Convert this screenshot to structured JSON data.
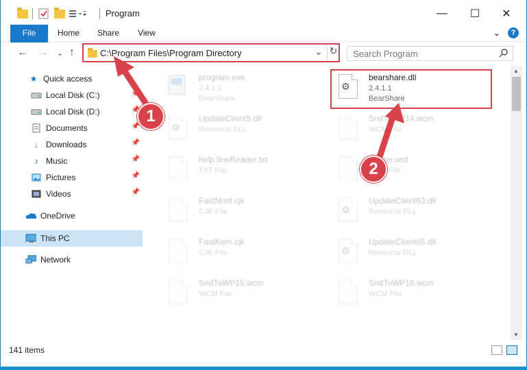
{
  "window": {
    "title": "Program",
    "minimize": "—",
    "maximize": "☐",
    "close": "✕"
  },
  "ribbon": {
    "tabs": [
      "File",
      "Home",
      "Share",
      "View"
    ],
    "expand": "⌄",
    "help": "?"
  },
  "nav": {
    "back": "←",
    "forward": "→",
    "recent": "⌄",
    "up": "↑"
  },
  "address": {
    "path": "C:\\Program Files\\Program Directory",
    "dropdown": "⌄",
    "refresh": "↻"
  },
  "search": {
    "placeholder": "Search Program",
    "icon": "⌕"
  },
  "sidebar": {
    "items": [
      {
        "label": "Quick access",
        "icon": "star-icon",
        "pinned": false
      },
      {
        "label": "Local Disk (C:)",
        "icon": "drive-icon",
        "pinned": true
      },
      {
        "label": "Local Disk (D:)",
        "icon": "drive-icon",
        "pinned": true
      },
      {
        "label": "Documents",
        "icon": "documents-icon",
        "pinned": true
      },
      {
        "label": "Downloads",
        "icon": "downloads-icon",
        "pinned": true
      },
      {
        "label": "Music",
        "icon": "music-icon",
        "pinned": true
      },
      {
        "label": "Pictures",
        "icon": "pictures-icon",
        "pinned": true
      },
      {
        "label": "Videos",
        "icon": "videos-icon",
        "pinned": true
      },
      {
        "label": "OneDrive",
        "icon": "onedrive-icon",
        "pinned": false
      },
      {
        "label": "This PC",
        "icon": "this-pc-icon",
        "pinned": false
      },
      {
        "label": "Network",
        "icon": "network-icon",
        "pinned": false
      }
    ]
  },
  "files": [
    {
      "name": "program.exe",
      "line1": "2.4.1.1",
      "line2": "BearShare",
      "icon": "exe-icon",
      "faded": true
    },
    {
      "name": "bearshare.dll",
      "line1": "2.4.1.1",
      "line2": "BearShare",
      "icon": "dll-icon",
      "faded": false
    },
    {
      "name": "UpdateClient5.dll",
      "line1": "Resource DLL",
      "line2": "",
      "icon": "dll-icon",
      "faded": true
    },
    {
      "name": "SndToWP14.wcm",
      "line1": "WCM File",
      "line2": "",
      "icon": "file-icon",
      "faded": true
    },
    {
      "name": "help.fineReader.txt",
      "line1": "TXT File",
      "line2": "",
      "icon": "file-icon",
      "faded": true
    },
    {
      "name": "Printer.wrd",
      "line1": "WRD File",
      "line2": "",
      "icon": "file-icon",
      "faded": true
    },
    {
      "name": "FastNrml.cjk",
      "line1": "CJK File",
      "line2": "",
      "icon": "file-icon",
      "faded": true
    },
    {
      "name": "UpdateClient63.dll",
      "line1": "Resource DLL",
      "line2": "",
      "icon": "dll-icon",
      "faded": true
    },
    {
      "name": "FastKorn.cjk",
      "line1": "CJK File",
      "line2": "",
      "icon": "file-icon",
      "faded": true
    },
    {
      "name": "UpdateClient65.dll",
      "line1": "Resource DLL",
      "line2": "",
      "icon": "dll-icon",
      "faded": true
    },
    {
      "name": "SndToWP15.wcm",
      "line1": "WCM File",
      "line2": "",
      "icon": "file-icon",
      "faded": true
    },
    {
      "name": "SndToWP16.wcm",
      "line1": "WCM File",
      "line2": "",
      "icon": "file-icon",
      "faded": true
    }
  ],
  "status": {
    "count": "141 items"
  },
  "annotations": {
    "step1": "1",
    "step2": "2",
    "color": "#d9424a"
  }
}
